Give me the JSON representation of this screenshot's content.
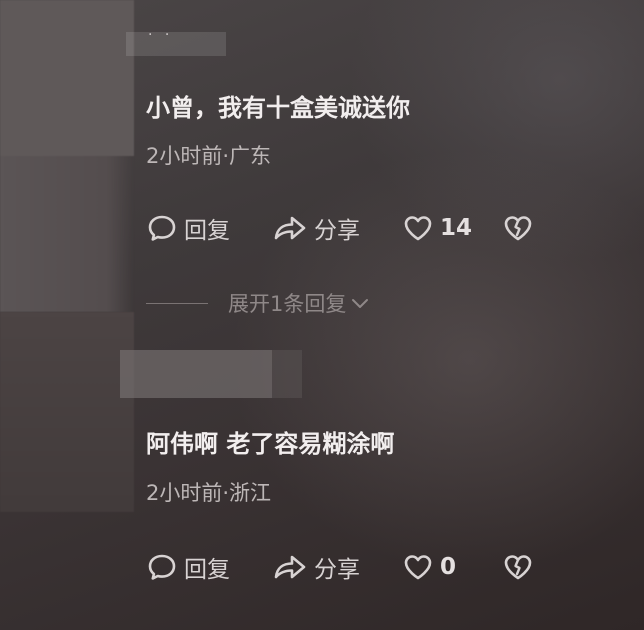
{
  "comments": [
    {
      "text": "小曾，我有十盒美诚送你",
      "meta": "2小时前·广东",
      "reply_label": "回复",
      "share_label": "分享",
      "like_count": "14",
      "name_placeholder": "· ·"
    },
    {
      "text": "阿伟啊 老了容易糊涂啊",
      "meta": "2小时前·浙江",
      "reply_label": "回复",
      "share_label": "分享",
      "like_count": "0"
    }
  ],
  "expand_replies": {
    "label": "展开1条回复"
  },
  "icons": {
    "reply": "comment-bubble-icon",
    "share": "share-arrow-icon",
    "like": "heart-outline-icon",
    "dislike": "broken-heart-icon",
    "expand": "chevron-down-icon"
  },
  "colors": {
    "text_primary": "#f2eeee",
    "text_meta": "#bdb7b7",
    "text_muted": "#8f8888"
  }
}
